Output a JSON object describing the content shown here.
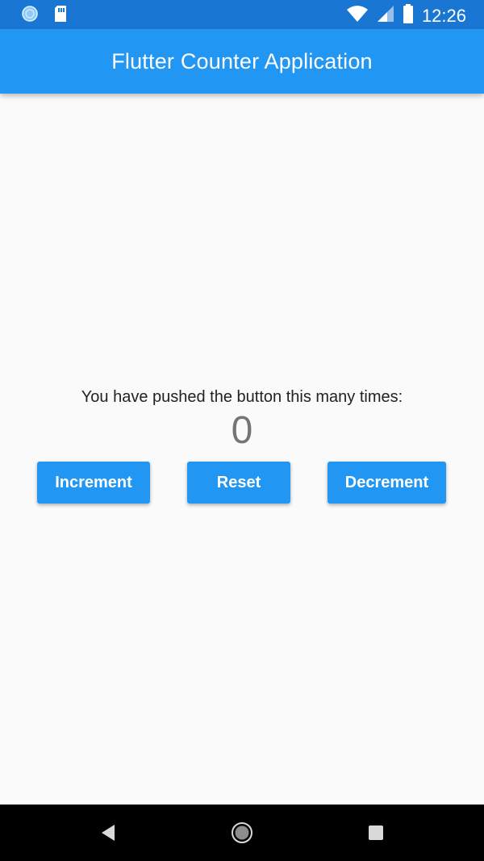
{
  "status_bar": {
    "time": "12:26",
    "icons": [
      "sync-icon",
      "sd-card-icon",
      "wifi-icon",
      "signal-icon",
      "battery-icon"
    ]
  },
  "app_bar": {
    "title": "Flutter Counter Application"
  },
  "main": {
    "message": "You have pushed the button this many times:",
    "counter": "0",
    "buttons": {
      "increment": "Increment",
      "reset": "Reset",
      "decrement": "Decrement"
    }
  },
  "nav_bar": {
    "icons": [
      "back-icon",
      "home-icon",
      "recent-apps-icon"
    ]
  },
  "colors": {
    "app_bar": "#2196f3",
    "status_bar": "#1976d2",
    "background": "#fafafa",
    "button": "#2196f3"
  }
}
